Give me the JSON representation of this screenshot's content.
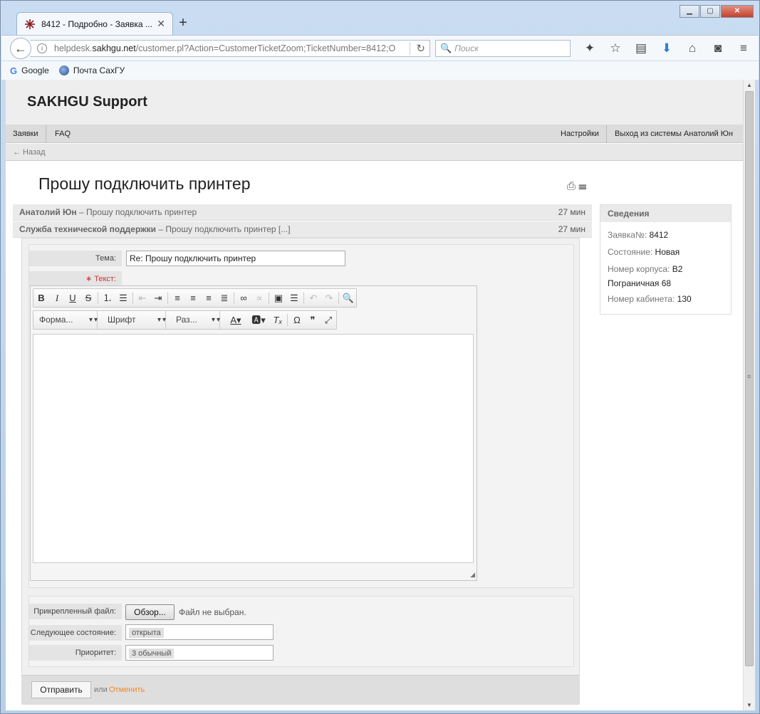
{
  "browser": {
    "tab_title": "8412 - Подробно - Заявка ...",
    "url_prefix": "helpdesk.",
    "url_host": "sakhgu.net",
    "url_path": "/customer.pl?Action=CustomerTicketZoom;TicketNumber=8412;O",
    "search_placeholder": "Поиск",
    "bookmarks": [
      "Google",
      "Почта СахГУ"
    ]
  },
  "header": {
    "brand": "SAKHGU Support"
  },
  "menu": {
    "tickets": "Заявки",
    "faq": "FAQ",
    "settings": "Настройки",
    "logout": "Выход из системы Анатолий Юн"
  },
  "breadcrumb": {
    "back": "← Назад"
  },
  "ticket": {
    "title": "Прошу подключить принтер",
    "articles": [
      {
        "from": "Анатолий Юн",
        "subject": " – Прошу подключить принтер",
        "age": "27 мин"
      },
      {
        "from": "Служба технической поддержки",
        "subject": " – Прошу подключить принтер [...]",
        "age": "27 мин"
      }
    ]
  },
  "info": {
    "heading": "Сведения",
    "ticket_label": "Заявка№: ",
    "ticket_value": "8412",
    "state_label": "Состояние: ",
    "state_value": "Новая",
    "building_label": "Номер корпуса: ",
    "building_value_1": "B2",
    "building_value_2": "Пограничная 68",
    "room_label": "Номер кабинета: ",
    "room_value": "130"
  },
  "reply": {
    "subject_label": "Тема:",
    "subject_value": "Re: Прошу подключить принтер",
    "text_label": "∗ Текст:",
    "editor": {
      "format": "Форма...",
      "font": "Шрифт",
      "size": "Раз..."
    },
    "attachment_label": "Прикрепленный файл:",
    "browse": "Обзор...",
    "no_file": "Файл не выбран.",
    "next_state_label": "Следующее состояние:",
    "next_state_value": "открыта",
    "priority_label": "Приоритет:",
    "priority_value": "3 обычный",
    "submit": "Отправить",
    "or": "или",
    "cancel": "Отменить"
  }
}
